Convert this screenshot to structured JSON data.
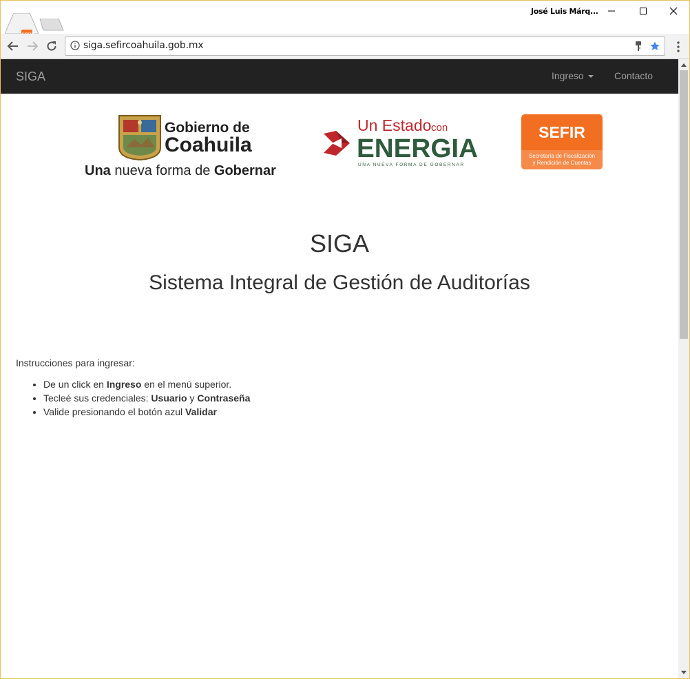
{
  "browser": {
    "tab_favicon_text": "SEFIR",
    "profile_name": "José Luis Márq...",
    "url": "siga.sefircoahuila.gob.mx",
    "icons": [
      "back-icon",
      "forward-icon",
      "reload-icon",
      "info-icon",
      "key-icon",
      "star-icon",
      "menu-icon",
      "minimize-icon",
      "maximize-icon",
      "close-icon"
    ],
    "accent": "#4285f4"
  },
  "navbar": {
    "brand": "SIGA",
    "ingreso": "Ingreso",
    "contacto": "Contacto",
    "background": "#222222"
  },
  "logos": {
    "coahuila": {
      "line1": "Gobierno de",
      "line2": "Coahuila",
      "tagline_bold1": "Una",
      "tagline_mid": " nueva forma de ",
      "tagline_bold2": "Gobernar"
    },
    "energia": {
      "line1": "Un Estado",
      "line1_small": "con",
      "line2": "ENERGIA",
      "tagline": "UNA NUEVA FORMA DE GOBERNAR",
      "red": "#c0272d",
      "green": "#2f5b3d"
    },
    "sefir": {
      "title": "SEFIR",
      "subtitle1": "Secretaría de Fiscalización",
      "subtitle2": "y Rendición de Cuentas",
      "color": "#f26f21"
    }
  },
  "main": {
    "title": "SIGA",
    "subtitle": "Sistema Integral de Gestión de Auditorías",
    "instructions_label": "Instrucciones para ingresar:",
    "steps": [
      {
        "pre": "De un click en ",
        "bold": "Ingreso",
        "post": " en el menú superior."
      },
      {
        "pre": "Tecleé sus credenciales: ",
        "bold": "Usuario",
        "mid": " y ",
        "bold2": "Contraseña"
      },
      {
        "pre": "Valide presionando el botón azul ",
        "bold": "Validar"
      }
    ]
  }
}
